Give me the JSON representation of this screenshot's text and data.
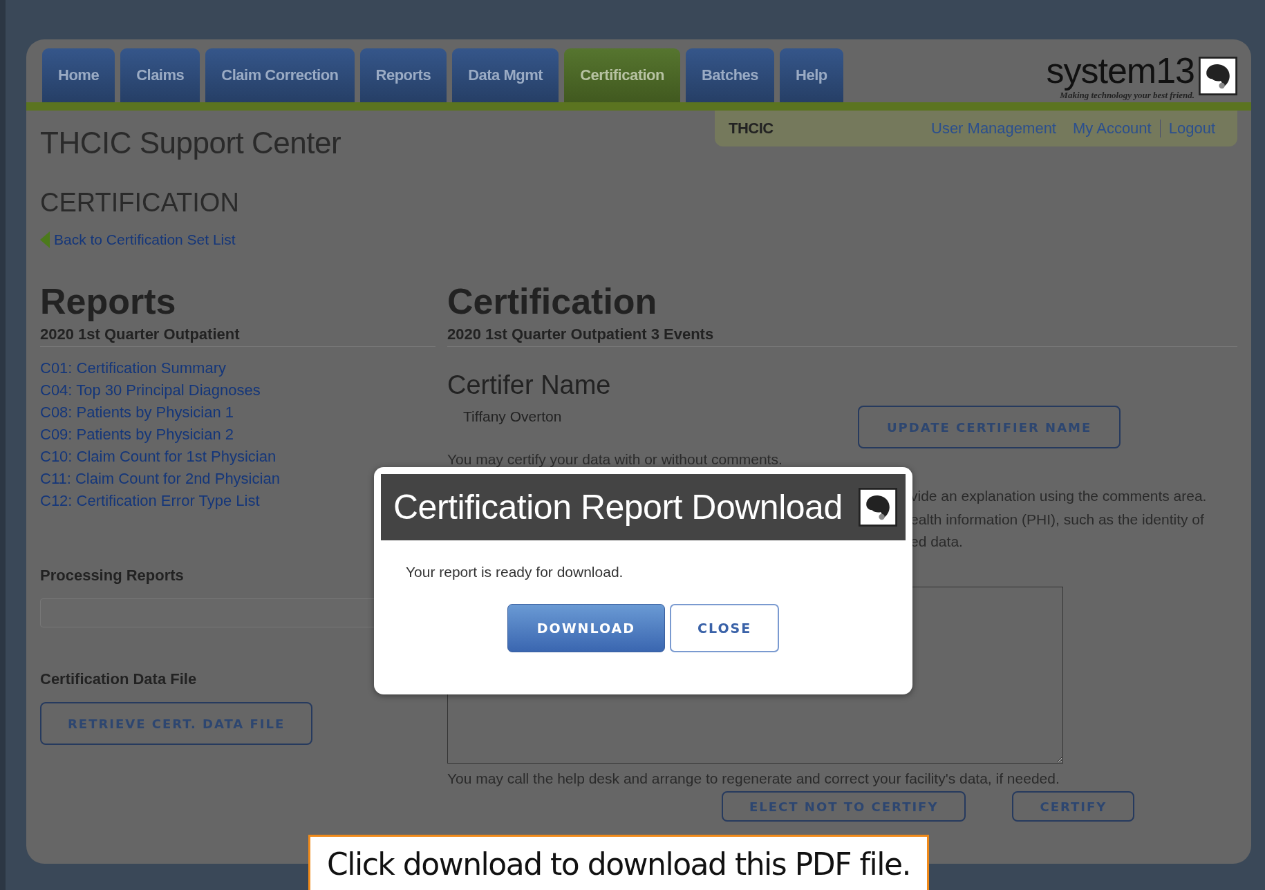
{
  "nav": {
    "tabs": [
      {
        "label": "Home",
        "selected": false
      },
      {
        "label": "Claims",
        "selected": false
      },
      {
        "label": "Claim Correction",
        "selected": false
      },
      {
        "label": "Reports",
        "selected": false
      },
      {
        "label": "Data Mgmt",
        "selected": false
      },
      {
        "label": "Certification",
        "selected": true
      },
      {
        "label": "Batches",
        "selected": false
      },
      {
        "label": "Help",
        "selected": false
      }
    ]
  },
  "brand": {
    "name": "system13",
    "tagline": "Making technology your best friend."
  },
  "user_bar": {
    "org": "THCIC",
    "links": [
      "User Management",
      "My Account",
      "Logout"
    ]
  },
  "page": {
    "title": "THCIC Support Center",
    "section": "CERTIFICATION",
    "back_link": "Back to Certification Set List"
  },
  "reports": {
    "heading": "Reports",
    "subheading": "2020 1st Quarter Outpatient",
    "links": [
      "C01: Certification Summary",
      "C04: Top 30 Principal Diagnoses",
      "C08: Patients by Physician 1",
      "C09: Patients by Physician 2",
      "C10: Claim Count for 1st Physician",
      "C11: Claim Count for 2nd Physician",
      "C12: Certification Error Type List"
    ],
    "processing_heading": "Processing Reports",
    "data_file_heading": "Certification Data File",
    "data_file_button": "RETRIEVE CERT. DATA FILE"
  },
  "certification": {
    "heading": "Certification",
    "subheading": "2020 1st Quarter Outpatient 3 Events",
    "certifier_heading": "Certifer Name",
    "certifier": "Tiffany Overton",
    "update_button": "UPDATE CERTIFIER NAME",
    "intro": "You may certify your data with or without comments.",
    "notes": [
      "vide an explanation using the comments area.",
      "ealth information (PHI), such as the identity of",
      "ed data."
    ],
    "help_text": "You may call the help desk and arrange to regenerate and correct your facility's data, if needed.",
    "buttons": [
      "ELECT NOT TO CERTIFY",
      "CERTIFY"
    ]
  },
  "dialog": {
    "title": "Certification Report Download",
    "message": "Your report is ready for download.",
    "buttons": [
      {
        "label": "DOWNLOAD",
        "kind": "primary"
      },
      {
        "label": "CLOSE",
        "kind": "secondary"
      }
    ]
  },
  "callout": "Click download to download this PDF file."
}
